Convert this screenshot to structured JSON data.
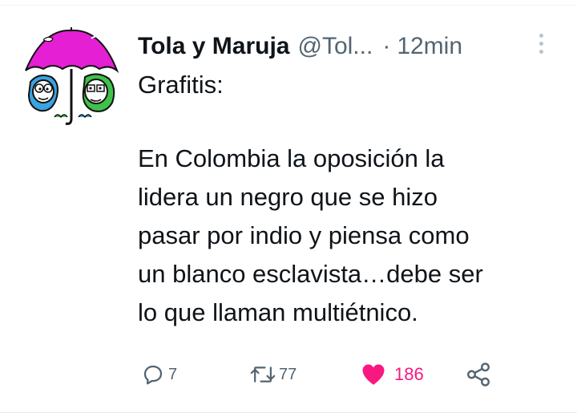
{
  "tweet": {
    "author": {
      "display_name": "Tola y Maruja",
      "handle": "@Tol...",
      "avatar_icon": "umbrella-cartoon-avatar"
    },
    "separator": "·",
    "timestamp": "12min",
    "text": {
      "line1": "Grafitis:",
      "line2": "En Colombia la oposición la",
      "line3": "lidera un negro que se hizo",
      "line4": "pasar por indio y piensa como",
      "line5": "un blanco esclavista…debe ser",
      "line6": "lo que llaman multiétnico."
    },
    "actions": {
      "reply": {
        "icon": "reply-icon",
        "count": "7"
      },
      "retweet": {
        "icon": "retweet-icon",
        "count": "77"
      },
      "like": {
        "icon": "heart-icon",
        "count": "186",
        "liked": true
      },
      "share": {
        "icon": "share-icon"
      }
    }
  },
  "colors": {
    "text_primary": "#0f1419",
    "text_secondary": "#536471",
    "like_pink": "#f91880",
    "umbrella_magenta": "#e51fd3"
  }
}
